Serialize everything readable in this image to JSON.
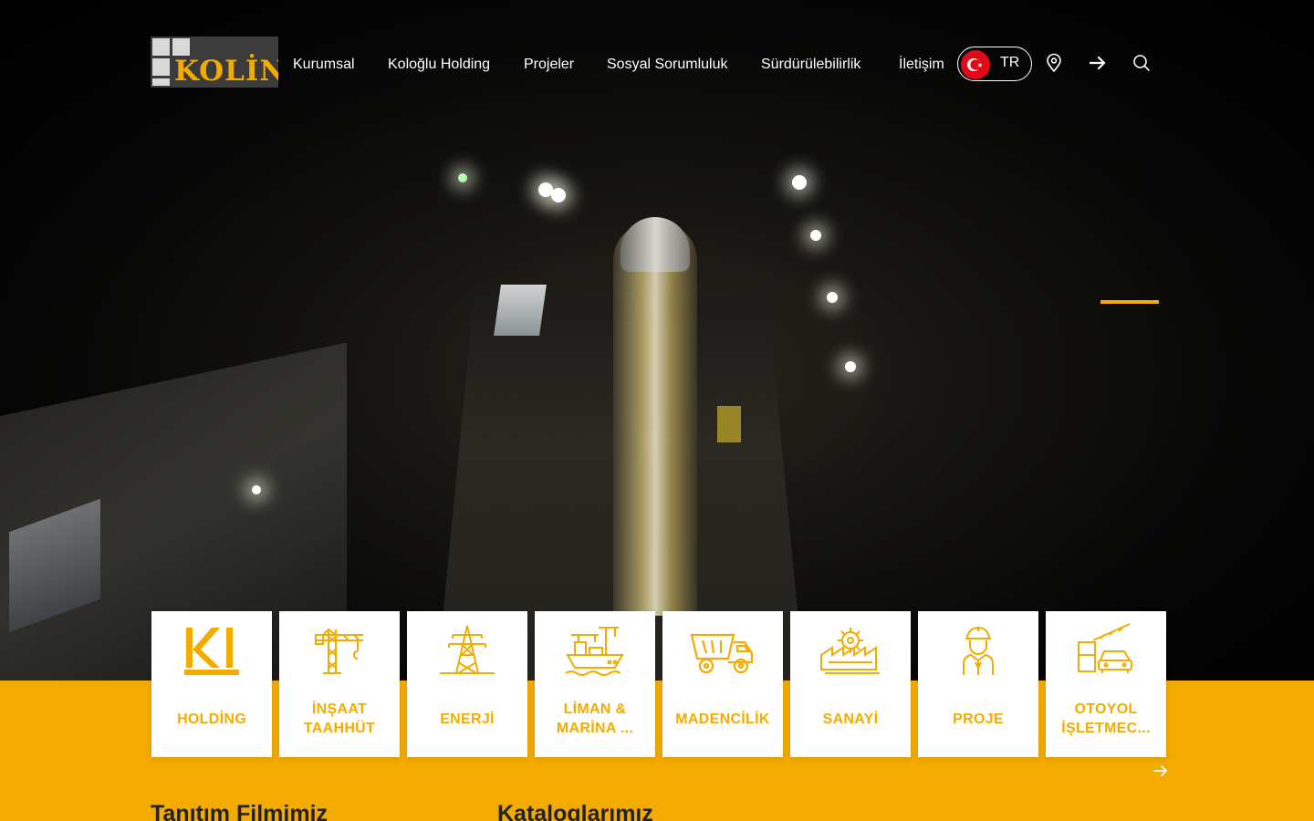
{
  "header": {
    "logo_text": "KOLİN",
    "nav": [
      {
        "label": "Kurumsal"
      },
      {
        "label": "Koloğlu Holding"
      },
      {
        "label": "Projeler"
      },
      {
        "label": "Sosyal Sorumluluk"
      },
      {
        "label": "Sürdürülebilirlik"
      },
      {
        "label": "İletişim"
      }
    ],
    "language": {
      "code": "TR",
      "flag_icon": "turkey-flag-icon"
    },
    "icons": [
      "location-pin-icon",
      "arrow-right-icon",
      "search-icon"
    ]
  },
  "hero": {
    "background_icon": "tunnel-construction-night-photo",
    "active_slide_color": "#f3ab00"
  },
  "sectors": [
    {
      "label": "HOLDİNG",
      "icon": "kolin-k-logo-icon"
    },
    {
      "label": "İNŞAAT TAAHHÜT",
      "icon": "tower-crane-icon"
    },
    {
      "label": "ENERJİ",
      "icon": "power-pylon-icon"
    },
    {
      "label": "LİMAN & MARİNA ...",
      "icon": "ship-port-crane-icon"
    },
    {
      "label": "MADENCİLİK",
      "icon": "mining-dump-truck-icon"
    },
    {
      "label": "SANAYİ",
      "icon": "factory-gear-icon"
    },
    {
      "label": "PROJE",
      "icon": "engineer-helmet-icon"
    },
    {
      "label": "OTOYOL İŞLETMEC...",
      "icon": "toll-gate-car-icon"
    }
  ],
  "sections": {
    "video_title": "Tanıtım Filmimiz",
    "catalog_title": "Kataloglarımız"
  },
  "colors": {
    "accent": "#f3ab00",
    "text_dark": "#222222",
    "nav_text": "#ffffff"
  }
}
